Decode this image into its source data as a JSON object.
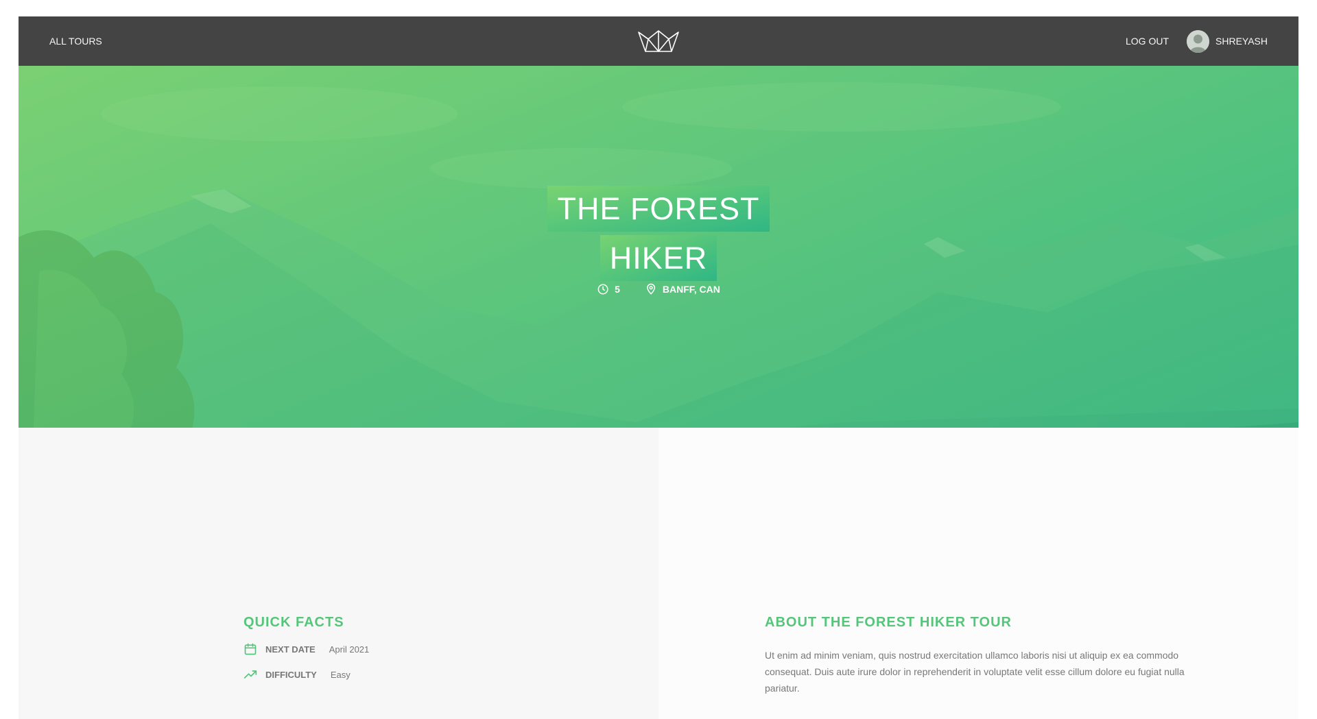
{
  "header": {
    "all_tours": "All tours",
    "logout": "Log out",
    "user_name": "SHREYASH"
  },
  "hero": {
    "title": "The Forest Hiker",
    "duration": "5",
    "location": "Banff, CAN"
  },
  "quick_facts": {
    "heading": "Quick facts",
    "facts": [
      {
        "label": "Next date",
        "value": "April 2021",
        "icon": "calendar-icon"
      },
      {
        "label": "Difficulty",
        "value": "Easy",
        "icon": "trending-up-icon"
      }
    ]
  },
  "about": {
    "heading": "About the forest hiker tour",
    "text": "Ut enim ad minim veniam, quis nostrud exercitation ullamco laboris nisi ut aliquip ex ea commodo consequat. Duis aute irure dolor in reprehenderit in voluptate velit esse cillum dolore eu fugiat nulla pariatur."
  },
  "colors": {
    "header_bg": "#444444",
    "accent_green": "#55c57a",
    "accent_teal": "#28b487",
    "text_grey": "#777777"
  }
}
